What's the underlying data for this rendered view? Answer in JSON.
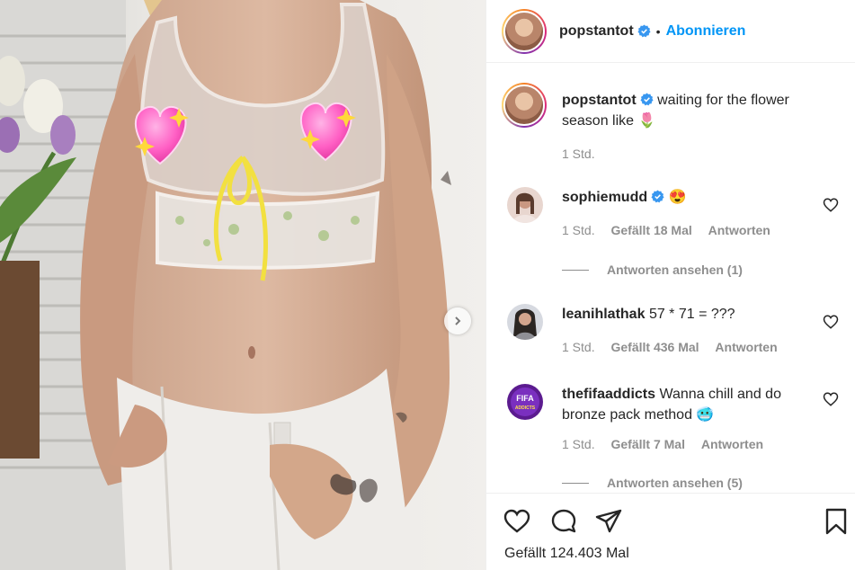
{
  "post": {
    "author": "popstantot",
    "follow_label": "Abonnieren",
    "separator": "•",
    "caption_text": "waiting for the flower season like 🌷",
    "caption_time": "1 Std.",
    "likes_label": "Gefällt 124.403 Mal"
  },
  "comments": [
    {
      "username": "sophiemudd",
      "verified": true,
      "text": "😍",
      "time": "1 Std.",
      "likes": "Gefällt 18 Mal",
      "reply_label": "Antworten",
      "view_replies": "Antworten ansehen (1)"
    },
    {
      "username": "leanihlathak",
      "verified": false,
      "text": "57 * 71 = ???",
      "time": "1 Std.",
      "likes": "Gefällt 436 Mal",
      "reply_label": "Antworten"
    },
    {
      "username": "thefifaaddicts",
      "verified": false,
      "text": "Wanna chill and do bronze pack method 🥶",
      "time": "1 Std.",
      "likes": "Gefällt 7 Mal",
      "reply_label": "Antworten",
      "view_replies": "Antworten ansehen (5)",
      "avatar_text": "FIFA ADDICTS"
    }
  ],
  "icons": {
    "verified": "verified-badge-icon",
    "next": "chevron-right-icon",
    "like": "heart-icon",
    "comment": "comment-icon",
    "share": "paper-plane-icon",
    "save": "bookmark-icon"
  },
  "colors": {
    "accent": "#0095f6",
    "secondary_text": "#8e8e8e",
    "border": "#efefef"
  }
}
